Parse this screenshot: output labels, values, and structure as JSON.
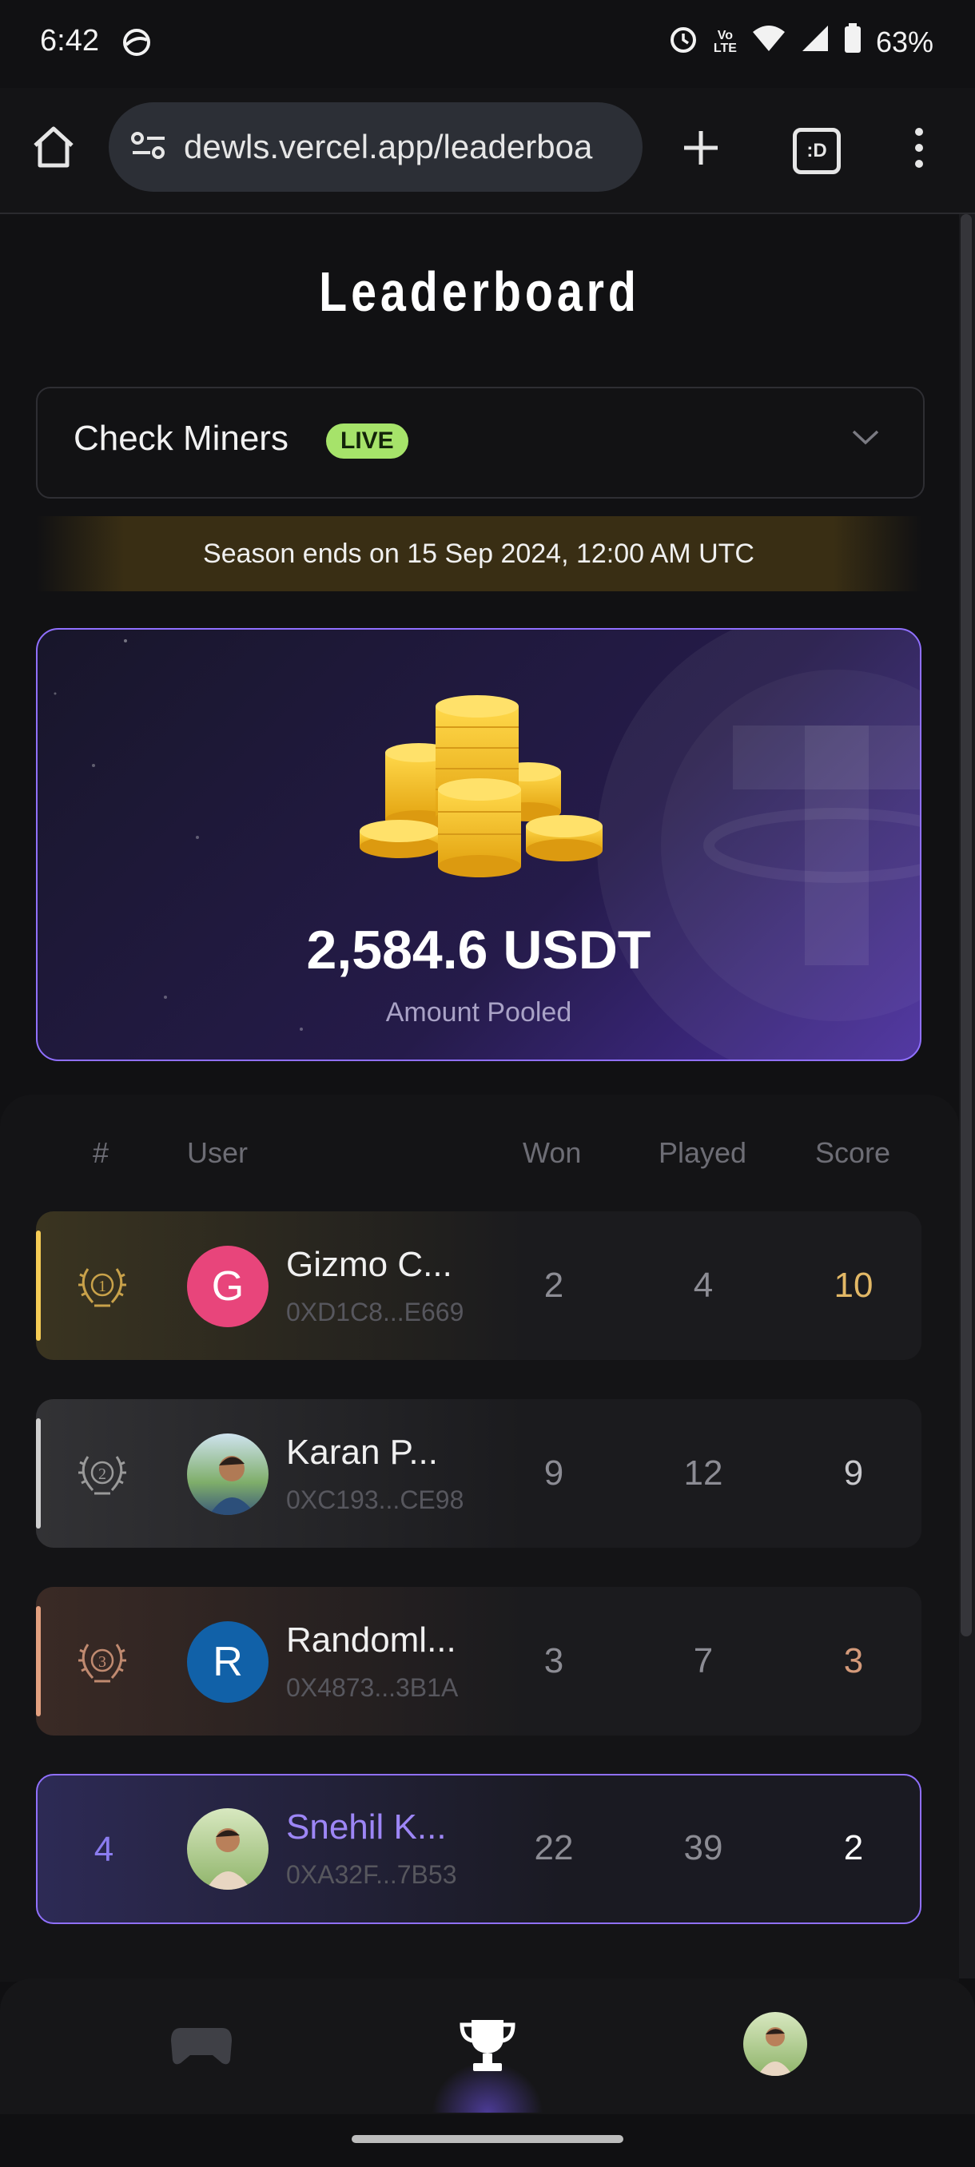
{
  "status_bar": {
    "time": "6:42",
    "battery": "63%",
    "network": "Vo\nLTE"
  },
  "browser": {
    "url": "dewls.vercel.app/leaderboa",
    "tab_label": ":D"
  },
  "page": {
    "title": "Leaderboard",
    "dropdown": {
      "label": "Check Miners",
      "badge": "LIVE"
    },
    "season_text": "Season ends on 15 Sep 2024, 12:00 AM UTC",
    "pool": {
      "amount": "2,584.6 USDT",
      "label": "Amount Pooled"
    },
    "table": {
      "headers": {
        "rank": "#",
        "user": "User",
        "won": "Won",
        "played": "Played",
        "score": "Score"
      },
      "rows": [
        {
          "rank": "1",
          "initial": "G",
          "name": "Gizmo C...",
          "address": "0XD1C8...E669",
          "won": "2",
          "played": "4",
          "score": "10"
        },
        {
          "rank": "2",
          "initial": "",
          "name": "Karan P...",
          "address": "0XC193...CE98",
          "won": "9",
          "played": "12",
          "score": "9"
        },
        {
          "rank": "3",
          "initial": "R",
          "name": "Randoml...",
          "address": "0X4873...3B1A",
          "won": "3",
          "played": "7",
          "score": "3"
        },
        {
          "rank": "4",
          "initial": "",
          "name": "Snehil K...",
          "address": "0XA32F...7B53",
          "won": "22",
          "played": "39",
          "score": "2"
        }
      ]
    }
  },
  "colors": {
    "gold": "#f5cc55",
    "silver": "#cfcfcf",
    "bronze": "#e3a07f",
    "purple": "#9070ff",
    "live": "#a6e36a"
  },
  "bottom_nav": {
    "items": [
      "gamepad-icon",
      "trophy-icon",
      "profile-avatar"
    ]
  }
}
